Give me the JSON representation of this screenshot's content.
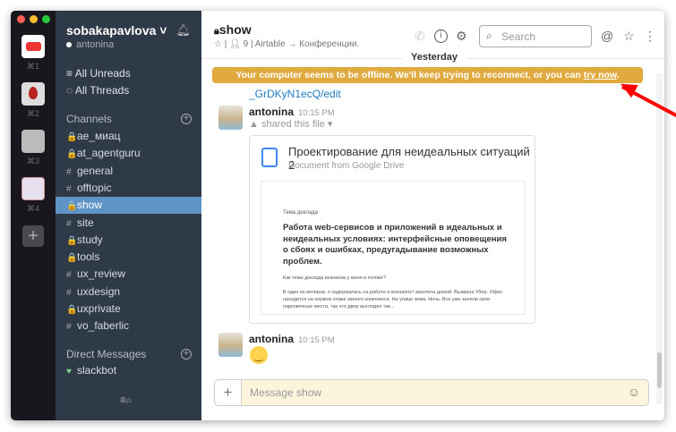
{
  "teams": [
    {
      "shortcut": "⌘1",
      "color": "#ffffff"
    },
    {
      "shortcut": "⌘2",
      "color": "#dcdcdc"
    },
    {
      "shortcut": "⌘3",
      "color": "#bdbdbd"
    },
    {
      "shortcut": "⌘4",
      "color": "#e6dfee"
    }
  ],
  "workspace": {
    "name": "sobakapavlova ˅",
    "user": "antonina"
  },
  "nav": {
    "unreads": "All Unreads",
    "threads": "All Threads"
  },
  "channels_label": "Channels",
  "channels": [
    {
      "name": "ae_миац",
      "prefix": "🔒"
    },
    {
      "name": "at_agentguru",
      "prefix": "🔒"
    },
    {
      "name": "general",
      "prefix": "#"
    },
    {
      "name": "offtopic",
      "prefix": "#"
    },
    {
      "name": "show",
      "prefix": "🔒"
    },
    {
      "name": "site",
      "prefix": "#"
    },
    {
      "name": "study",
      "prefix": "🔒"
    },
    {
      "name": "tools",
      "prefix": "🔒"
    },
    {
      "name": "ux_review",
      "prefix": "#"
    },
    {
      "name": "uxdesign",
      "prefix": "#"
    },
    {
      "name": "uxprivate",
      "prefix": "🔒"
    },
    {
      "name": "vo_faberlic",
      "prefix": "#"
    }
  ],
  "dm_label": "Direct Messages",
  "dms": [
    {
      "name": "slackbot"
    }
  ],
  "header": {
    "title": "show",
    "members": "9",
    "topic": "Airtable → Конференции.",
    "search_placeholder": "Search"
  },
  "divider": "Yesterday",
  "banner": {
    "text": "Your computer seems to be offline. We'll keep trying to reconnect, or you can ",
    "link": "try now",
    "end": "."
  },
  "link_text": "_GrDKyN1ecQ/edit",
  "messages": [
    {
      "user": "antonina",
      "time": "10:15 PM",
      "action": "shared this file ▾"
    },
    {
      "user": "antonina",
      "time": "10:15 PM",
      "emoji": "🙂"
    }
  ],
  "file": {
    "title": "Проектирование для неидеальных ситуаций 2",
    "source": "Document from Google Drive",
    "preview": {
      "label": "Тема доклада",
      "heading": "Работа web-сервисов и приложений в идеальных и неидеальных условиях: интерфейсные оповещения о сбоях и ошибках, предугадывание возможных проблем.",
      "question": "Как тема доклада возникла у меня в голове?",
      "body": "В один из вечеров, я задержалась на работе и внезапно! захотела домой. Вызвала Убер. Офис находится на первом этаже жилого комплекса. На улице зима. Ночь. Все уже заняли свои парковочные места, так что двор выглядел так..."
    }
  },
  "composer": {
    "placeholder": "Message show"
  }
}
